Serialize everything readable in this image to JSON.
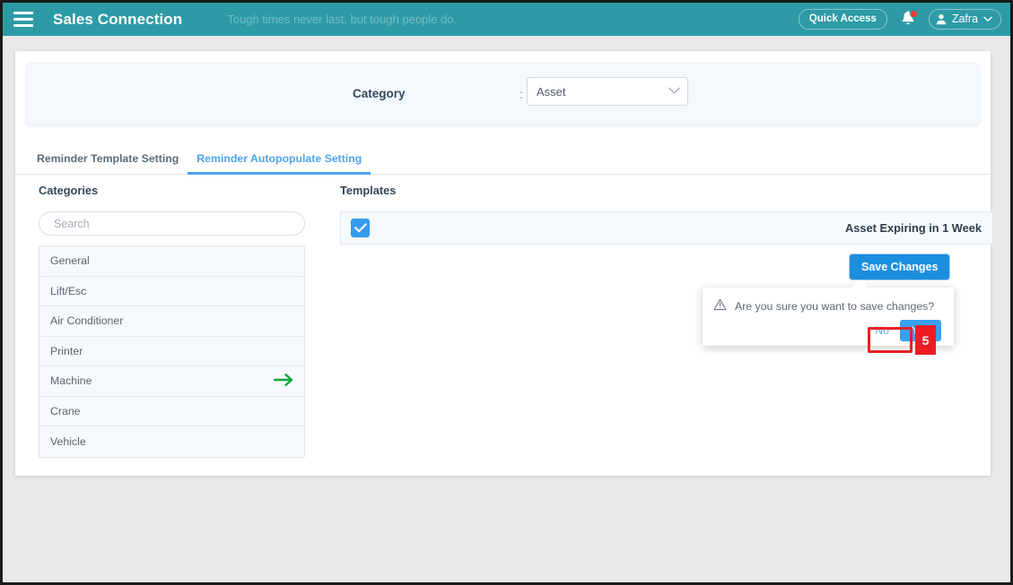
{
  "topbar": {
    "menu_icon": "hamburger-icon",
    "brand": "Sales Connection",
    "tagline": "Tough times never last, but tough people do.",
    "quick_access": "Quick Access",
    "bell_icon": "notification-bell-icon",
    "user_name": "Zafra",
    "user_icon": "user-avatar-icon",
    "teal": "#2d9ba6"
  },
  "category_filter": {
    "label": "Category",
    "colon": ":",
    "value": "Asset",
    "caret_icon": "chevron-down-icon"
  },
  "tabs": [
    {
      "label": "Reminder Template Setting",
      "active": false
    },
    {
      "label": "Reminder Autopopulate Setting",
      "active": true
    }
  ],
  "categories": {
    "title": "Categories",
    "search_placeholder": "Search",
    "search_value": "",
    "items": [
      {
        "label": "General",
        "selected": false
      },
      {
        "label": "Lift/Esc",
        "selected": false
      },
      {
        "label": "Air Conditioner",
        "selected": false
      },
      {
        "label": "Printer",
        "selected": false
      },
      {
        "label": "Machine",
        "selected": true,
        "arrow_icon": "arrow-right-icon"
      },
      {
        "label": "Crane",
        "selected": false
      },
      {
        "label": "Vehicle",
        "selected": false
      }
    ]
  },
  "templates": {
    "title": "Templates",
    "rows": [
      {
        "checked": true,
        "name": "Asset Expiring in 1 Week"
      }
    ],
    "save_label": "Save Changes"
  },
  "confirm_popover": {
    "warning_icon": "warning-triangle-icon",
    "message": "Are you sure you want to save changes?",
    "no_label": "No",
    "yes_label": "Yes"
  },
  "annotation": {
    "step": "5",
    "color": "#ed1c24"
  }
}
